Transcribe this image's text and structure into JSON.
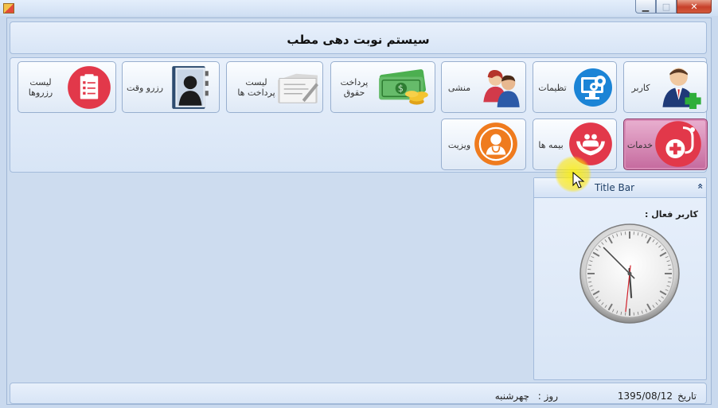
{
  "window": {
    "minimize_glyph": "▁",
    "maximize_glyph": "□",
    "close_glyph": "✕"
  },
  "header": {
    "title": "سیستم نوبت دهی مطب"
  },
  "toolbar": {
    "user": "کاربر",
    "settings": "تظیمات",
    "secretary": "منشی",
    "salary": "پرداخت\nحقوق",
    "payments_list": "لیست\nپرداخت ها",
    "booking": "رزرو وقت",
    "reservations_list": "لیست\nرزروها",
    "services": "خدمات",
    "insurance": "بیمه ها",
    "visit": "ویزیت"
  },
  "side_panel": {
    "title": "Title Bar",
    "collapse_glyph": "«",
    "active_user_label": "کاربر فعال :"
  },
  "clock": {
    "hour": 5,
    "minute": 52,
    "second": 31
  },
  "status": {
    "date_label": "تاریخ",
    "date_value": "1395/08/12",
    "day_label": "روز :",
    "day_value": "چهرشنبه"
  },
  "colors": {
    "accent_red": "#e2384a",
    "accent_orange": "#ef7b1e",
    "accent_blue": "#1b84d6",
    "active_button": "#c56a9e"
  }
}
